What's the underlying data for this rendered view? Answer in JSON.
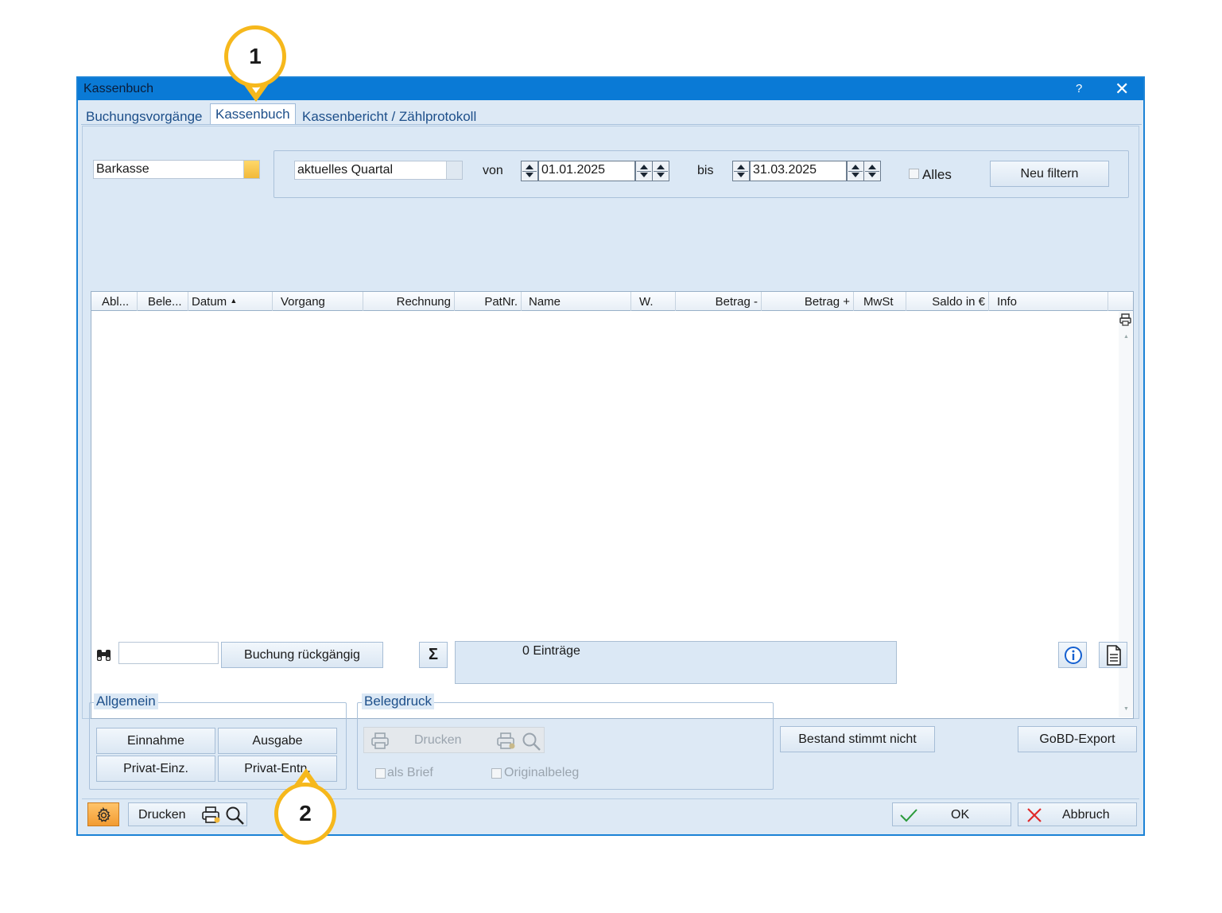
{
  "window": {
    "title": "Kassenbuch",
    "help": "?",
    "close": "✕"
  },
  "tabs": [
    {
      "label": "Buchungsvorgänge"
    },
    {
      "label": "Kassenbuch",
      "active": true
    },
    {
      "label": "Kassenbericht / Zählprotokoll"
    }
  ],
  "filter": {
    "kasse": "Barkasse",
    "zeitraum": "aktuelles Quartal",
    "von_label": "von",
    "von": "01.01.2025",
    "bis_label": "bis",
    "bis": "31.03.2025",
    "alles_label": "Alles",
    "neu_filtern": "Neu filtern"
  },
  "grid": {
    "columns": [
      "Abl...",
      "Bele...",
      "Datum",
      "Vorgang",
      "Rechnung",
      "PatNr.",
      "Name",
      "W.",
      "Betrag -",
      "Betrag +",
      "MwSt",
      "Saldo in €",
      "Info"
    ],
    "rows": []
  },
  "toolbar": {
    "search_value": "",
    "undo": "Buchung rückgängig",
    "sum_symbol": "Σ",
    "entries": "0 Einträge"
  },
  "allgemein": {
    "legend": "Allgemein",
    "einnahme": "Einnahme",
    "ausgabe": "Ausgabe",
    "privat_einz": "Privat-Einz.",
    "privat_entn": "Privat-Entn."
  },
  "belegdruck": {
    "legend": "Belegdruck",
    "drucken": "Drucken",
    "als_brief": "als Brief",
    "originalbeleg": "Originalbeleg"
  },
  "actions": {
    "bestand": "Bestand stimmt nicht",
    "gobd": "GoBD-Export",
    "drucken": "Drucken",
    "ok": "OK",
    "abbruch": "Abbruch"
  },
  "callouts": {
    "one": "1",
    "two": "2"
  },
  "colors": {
    "titlebar": "#0a7ad6",
    "callout_ring": "#f6b81c",
    "ok_check": "#2a9a3a",
    "cancel_x": "#e02a2a"
  }
}
